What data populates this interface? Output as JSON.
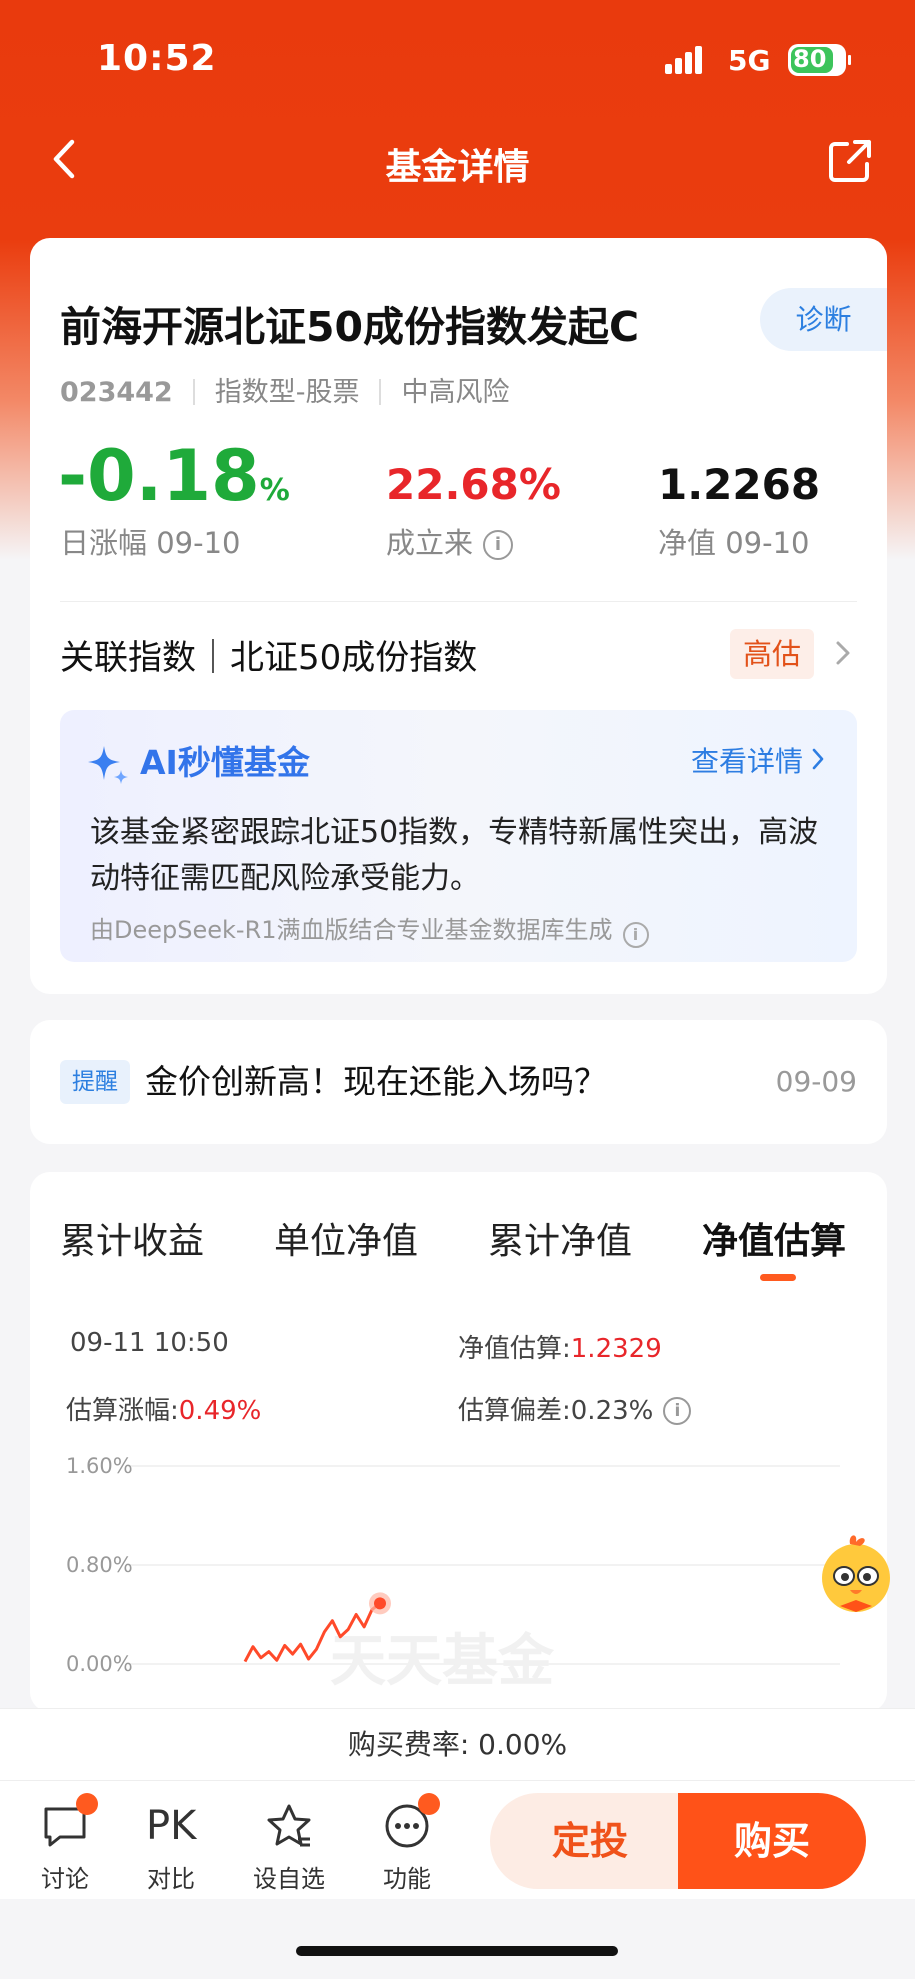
{
  "status": {
    "time": "10:52",
    "network": "5G",
    "battery": "80"
  },
  "header": {
    "title": "基金详情"
  },
  "fund": {
    "name": "前海开源北证50成份指数发起C",
    "diagnose_label": "诊断",
    "code": "023442",
    "type": "指数型-股票",
    "risk": "中高风险",
    "daily_change": "-0.18",
    "daily_change_unit": "%",
    "daily_change_label": "日涨幅 09-10",
    "since_inception": "22.68%",
    "since_inception_label": "成立来",
    "nav": "1.2268",
    "nav_label": "净值 09-10"
  },
  "related_index": {
    "text": "关联指数｜北证50成份指数",
    "badge": "高估"
  },
  "ai": {
    "title": "AI秒懂基金",
    "link": "查看详情",
    "text": "该基金紧密跟踪北证50指数，专精特新属性突出，高波动特征需匹配风险承受能力。",
    "footer": "由DeepSeek-R1满血版结合专业基金数据库生成"
  },
  "reminder": {
    "badge": "提醒",
    "text": "金价创新高！现在还能入场吗？",
    "date": "09-09"
  },
  "tabs": [
    "累计收益",
    "单位净值",
    "累计净值",
    "净值估算"
  ],
  "estimate": {
    "datetime": "09-11 10:50",
    "nav_label": "净值估算:",
    "nav_value": "1.2329",
    "change_label": "估算涨幅:",
    "change_value": "0.49%",
    "deviation_label": "估算偏差:",
    "deviation_value": "0.23%"
  },
  "chart_data": {
    "type": "line",
    "y_ticks": [
      "1.60%",
      "0.80%",
      "0.00%"
    ],
    "ylim": [
      0,
      1.6
    ],
    "grid": true,
    "watermark": "天天基金",
    "series": [
      {
        "values": [
          0.02,
          0.14,
          0.05,
          0.1,
          0.03,
          0.15,
          0.08,
          0.16,
          0.04,
          0.12,
          0.26,
          0.35,
          0.22,
          0.28,
          0.4,
          0.3,
          0.44,
          0.49
        ]
      }
    ]
  },
  "fee": {
    "label": "购买费率: 0.00%"
  },
  "bottom_bar": {
    "discuss": "讨论",
    "compare_icon_text": "PK",
    "compare": "对比",
    "watchlist": "设自选",
    "functions": "功能",
    "fixed_invest": "定投",
    "buy": "购买"
  },
  "colors": {
    "brand": "#e93a0d",
    "up": "#e8262a",
    "down": "#1faa3a",
    "link": "#2c7fe0",
    "buy": "#ff5218"
  }
}
